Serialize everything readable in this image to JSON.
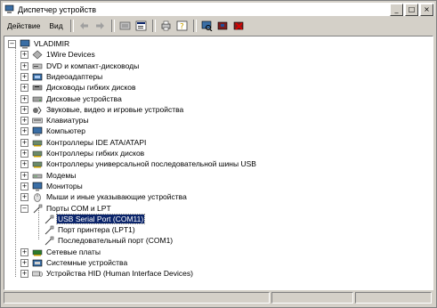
{
  "window": {
    "title": "Диспетчер устройств"
  },
  "menu": [
    {
      "label": "Действие"
    },
    {
      "label": "Вид"
    }
  ],
  "toolbar": {
    "buttons": [
      "back-icon",
      "forward-icon",
      "up-icon",
      "properties-icon",
      "print-icon",
      "help-icon",
      "scan-icon",
      "update-icon",
      "uninstall-icon"
    ]
  },
  "tree": {
    "root": "VLADIMIR",
    "items": [
      {
        "label": "1Wire Devices",
        "icon": "usb-key-icon",
        "expanded": false
      },
      {
        "label": "DVD и компакт-дисководы",
        "icon": "cdrom-icon",
        "expanded": false
      },
      {
        "label": "Видеоадаптеры",
        "icon": "display-adapter-icon",
        "expanded": false
      },
      {
        "label": "Дисководы гибких дисков",
        "icon": "floppy-icon",
        "expanded": false
      },
      {
        "label": "Дисковые устройства",
        "icon": "hard-disk-icon",
        "expanded": false
      },
      {
        "label": "Звуковые, видео и игровые устройства",
        "icon": "sound-icon",
        "expanded": false
      },
      {
        "label": "Клавиатуры",
        "icon": "keyboard-icon",
        "expanded": false
      },
      {
        "label": "Компьютер",
        "icon": "computer-icon",
        "expanded": false
      },
      {
        "label": "Контроллеры IDE ATA/ATAPI",
        "icon": "ide-controller-icon",
        "expanded": false
      },
      {
        "label": "Контроллеры гибких дисков",
        "icon": "floppy-controller-icon",
        "expanded": false
      },
      {
        "label": "Контроллеры универсальной последовательной шины USB",
        "icon": "usb-controller-icon",
        "expanded": false
      },
      {
        "label": "Модемы",
        "icon": "modem-icon",
        "expanded": false
      },
      {
        "label": "Мониторы",
        "icon": "monitor-icon",
        "expanded": false
      },
      {
        "label": "Мыши и иные указывающие устройства",
        "icon": "mouse-icon",
        "expanded": false
      },
      {
        "label": "Порты COM и LPT",
        "icon": "port-icon",
        "expanded": true,
        "children": [
          {
            "label": "USB Serial Port (COM11)",
            "icon": "port-icon",
            "selected": true
          },
          {
            "label": "Порт принтера (LPT1)",
            "icon": "port-icon",
            "selected": false
          },
          {
            "label": "Последовательный порт (COM1)",
            "icon": "port-icon",
            "selected": false
          }
        ]
      },
      {
        "label": "Сетевые платы",
        "icon": "network-card-icon",
        "expanded": false
      },
      {
        "label": "Системные устройства",
        "icon": "system-device-icon",
        "expanded": false
      },
      {
        "label": "Устройства HID (Human Interface Devices)",
        "icon": "hid-icon",
        "expanded": false
      }
    ]
  },
  "expander": {
    "collapsed": "+",
    "expanded": "−"
  },
  "window_buttons": {
    "minimize": "_",
    "maximize": "□",
    "close": "×"
  }
}
